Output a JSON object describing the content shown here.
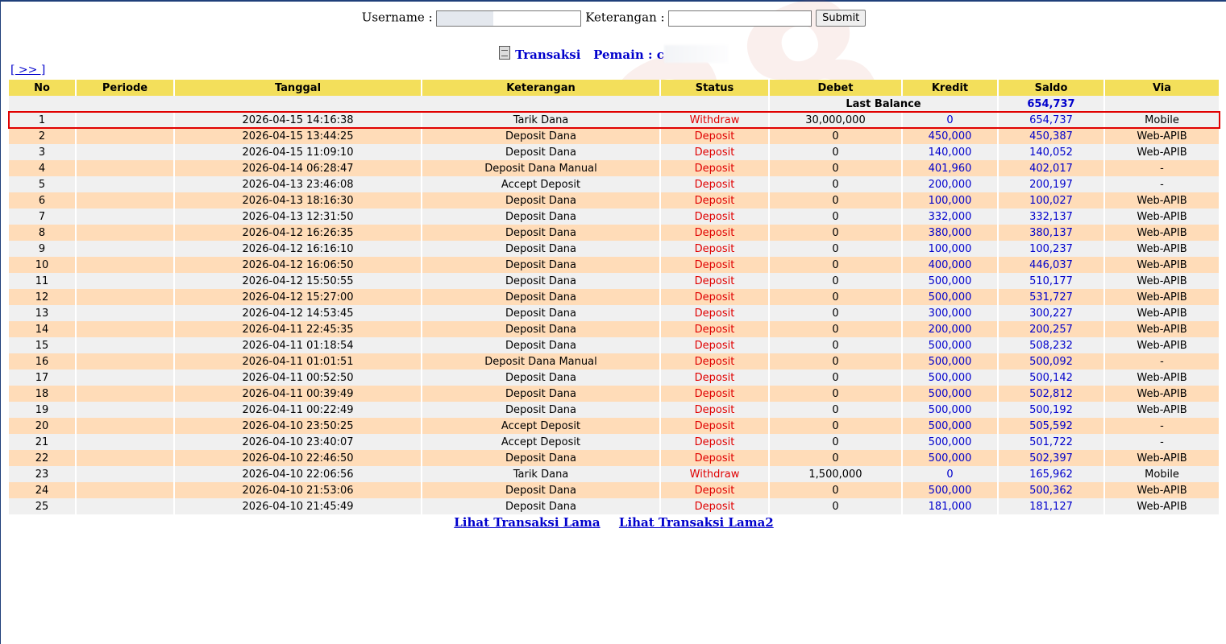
{
  "search": {
    "username_label": "Username :",
    "username_value": "",
    "keterangan_label": "Keterangan :",
    "keterangan_value": "",
    "submit_label": "Submit"
  },
  "title": {
    "transaksi": "Transaksi",
    "pemain": "Pemain : c"
  },
  "nav_next": "[ >> ]",
  "table": {
    "headers": [
      "No",
      "Periode",
      "Tanggal",
      "Keterangan",
      "Status",
      "Debet",
      "Kredit",
      "Saldo",
      "Via"
    ],
    "last_balance_label": "Last Balance",
    "last_balance_value": "654,737",
    "rows": [
      {
        "no": "1",
        "periode": "",
        "tanggal": "2026-04-15 14:16:38",
        "keterangan": "Tarik Dana",
        "status": "Withdraw",
        "debet": "30,000,000",
        "kredit": "0",
        "saldo": "654,737",
        "via": "Mobile"
      },
      {
        "no": "2",
        "periode": "",
        "tanggal": "2026-04-15 13:44:25",
        "keterangan": "Deposit Dana",
        "status": "Deposit",
        "debet": "0",
        "kredit": "450,000",
        "saldo": "450,387",
        "via": "Web-APIB"
      },
      {
        "no": "3",
        "periode": "",
        "tanggal": "2026-04-15 11:09:10",
        "keterangan": "Deposit Dana",
        "status": "Deposit",
        "debet": "0",
        "kredit": "140,000",
        "saldo": "140,052",
        "via": "Web-APIB"
      },
      {
        "no": "4",
        "periode": "",
        "tanggal": "2026-04-14 06:28:47",
        "keterangan": "Deposit Dana Manual",
        "status": "Deposit",
        "debet": "0",
        "kredit": "401,960",
        "saldo": "402,017",
        "via": "-"
      },
      {
        "no": "5",
        "periode": "",
        "tanggal": "2026-04-13 23:46:08",
        "keterangan": "Accept Deposit",
        "status": "Deposit",
        "debet": "0",
        "kredit": "200,000",
        "saldo": "200,197",
        "via": "-"
      },
      {
        "no": "6",
        "periode": "",
        "tanggal": "2026-04-13 18:16:30",
        "keterangan": "Deposit Dana",
        "status": "Deposit",
        "debet": "0",
        "kredit": "100,000",
        "saldo": "100,027",
        "via": "Web-APIB"
      },
      {
        "no": "7",
        "periode": "",
        "tanggal": "2026-04-13 12:31:50",
        "keterangan": "Deposit Dana",
        "status": "Deposit",
        "debet": "0",
        "kredit": "332,000",
        "saldo": "332,137",
        "via": "Web-APIB"
      },
      {
        "no": "8",
        "periode": "",
        "tanggal": "2026-04-12 16:26:35",
        "keterangan": "Deposit Dana",
        "status": "Deposit",
        "debet": "0",
        "kredit": "380,000",
        "saldo": "380,137",
        "via": "Web-APIB"
      },
      {
        "no": "9",
        "periode": "",
        "tanggal": "2026-04-12 16:16:10",
        "keterangan": "Deposit Dana",
        "status": "Deposit",
        "debet": "0",
        "kredit": "100,000",
        "saldo": "100,237",
        "via": "Web-APIB"
      },
      {
        "no": "10",
        "periode": "",
        "tanggal": "2026-04-12 16:06:50",
        "keterangan": "Deposit Dana",
        "status": "Deposit",
        "debet": "0",
        "kredit": "400,000",
        "saldo": "446,037",
        "via": "Web-APIB"
      },
      {
        "no": "11",
        "periode": "",
        "tanggal": "2026-04-12 15:50:55",
        "keterangan": "Deposit Dana",
        "status": "Deposit",
        "debet": "0",
        "kredit": "500,000",
        "saldo": "510,177",
        "via": "Web-APIB"
      },
      {
        "no": "12",
        "periode": "",
        "tanggal": "2026-04-12 15:27:00",
        "keterangan": "Deposit Dana",
        "status": "Deposit",
        "debet": "0",
        "kredit": "500,000",
        "saldo": "531,727",
        "via": "Web-APIB"
      },
      {
        "no": "13",
        "periode": "",
        "tanggal": "2026-04-12 14:53:45",
        "keterangan": "Deposit Dana",
        "status": "Deposit",
        "debet": "0",
        "kredit": "300,000",
        "saldo": "300,227",
        "via": "Web-APIB"
      },
      {
        "no": "14",
        "periode": "",
        "tanggal": "2026-04-11 22:45:35",
        "keterangan": "Deposit Dana",
        "status": "Deposit",
        "debet": "0",
        "kredit": "200,000",
        "saldo": "200,257",
        "via": "Web-APIB"
      },
      {
        "no": "15",
        "periode": "",
        "tanggal": "2026-04-11 01:18:54",
        "keterangan": "Deposit Dana",
        "status": "Deposit",
        "debet": "0",
        "kredit": "500,000",
        "saldo": "508,232",
        "via": "Web-APIB"
      },
      {
        "no": "16",
        "periode": "",
        "tanggal": "2026-04-11 01:01:51",
        "keterangan": "Deposit Dana Manual",
        "status": "Deposit",
        "debet": "0",
        "kredit": "500,000",
        "saldo": "500,092",
        "via": "-"
      },
      {
        "no": "17",
        "periode": "",
        "tanggal": "2026-04-11 00:52:50",
        "keterangan": "Deposit Dana",
        "status": "Deposit",
        "debet": "0",
        "kredit": "500,000",
        "saldo": "500,142",
        "via": "Web-APIB"
      },
      {
        "no": "18",
        "periode": "",
        "tanggal": "2026-04-11 00:39:49",
        "keterangan": "Deposit Dana",
        "status": "Deposit",
        "debet": "0",
        "kredit": "500,000",
        "saldo": "502,812",
        "via": "Web-APIB"
      },
      {
        "no": "19",
        "periode": "",
        "tanggal": "2026-04-11 00:22:49",
        "keterangan": "Deposit Dana",
        "status": "Deposit",
        "debet": "0",
        "kredit": "500,000",
        "saldo": "500,192",
        "via": "Web-APIB"
      },
      {
        "no": "20",
        "periode": "",
        "tanggal": "2026-04-10 23:50:25",
        "keterangan": "Accept Deposit",
        "status": "Deposit",
        "debet": "0",
        "kredit": "500,000",
        "saldo": "505,592",
        "via": "-"
      },
      {
        "no": "21",
        "periode": "",
        "tanggal": "2026-04-10 23:40:07",
        "keterangan": "Accept Deposit",
        "status": "Deposit",
        "debet": "0",
        "kredit": "500,000",
        "saldo": "501,722",
        "via": "-"
      },
      {
        "no": "22",
        "periode": "",
        "tanggal": "2026-04-10 22:46:50",
        "keterangan": "Deposit Dana",
        "status": "Deposit",
        "debet": "0",
        "kredit": "500,000",
        "saldo": "502,397",
        "via": "Web-APIB"
      },
      {
        "no": "23",
        "periode": "",
        "tanggal": "2026-04-10 22:06:56",
        "keterangan": "Tarik Dana",
        "status": "Withdraw",
        "debet": "1,500,000",
        "kredit": "0",
        "saldo": "165,962",
        "via": "Mobile"
      },
      {
        "no": "24",
        "periode": "",
        "tanggal": "2026-04-10 21:53:06",
        "keterangan": "Deposit Dana",
        "status": "Deposit",
        "debet": "0",
        "kredit": "500,000",
        "saldo": "500,362",
        "via": "Web-APIB"
      },
      {
        "no": "25",
        "periode": "",
        "tanggal": "2026-04-10 21:45:49",
        "keterangan": "Deposit Dana",
        "status": "Deposit",
        "debet": "0",
        "kredit": "181,000",
        "saldo": "181,127",
        "via": "Web-APIB"
      }
    ]
  },
  "footer": {
    "link1": "Lihat Transaksi Lama",
    "link2": "Lihat Transaksi Lama2"
  },
  "colors": {
    "header_bg": "#f3df5b",
    "row_odd": "#f0f0f0",
    "row_even": "#ffdcb8",
    "status_red": "#e00000",
    "link_blue": "#0000cc",
    "highlight_border": "#e00000"
  }
}
